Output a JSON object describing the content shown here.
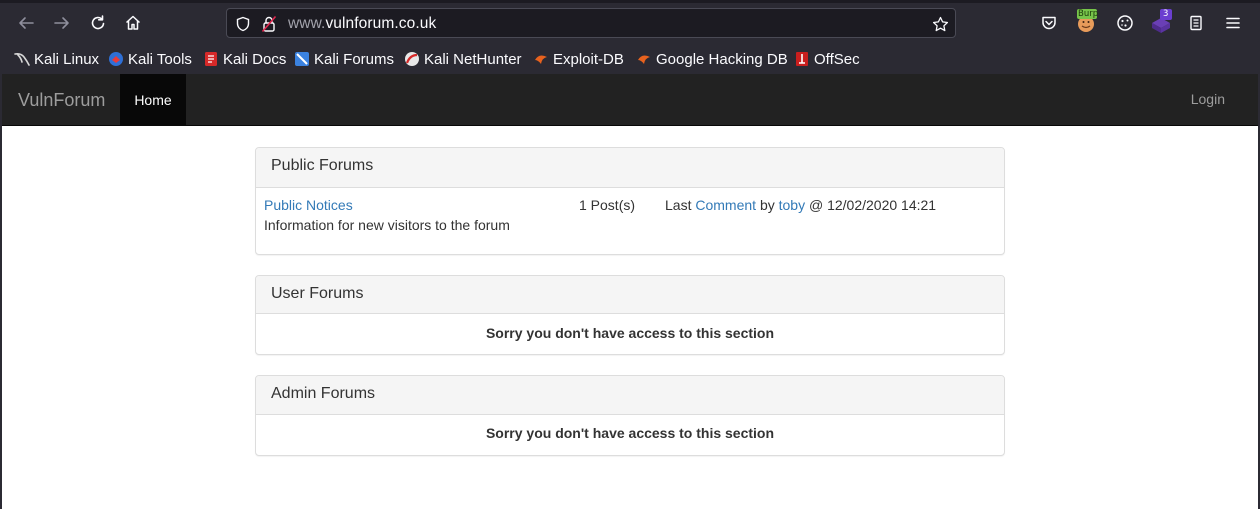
{
  "browser": {
    "url_prefix": "www.",
    "url_domain": "vulnforum.co.uk",
    "icons": {
      "back": "back-arrow-icon",
      "forward": "forward-arrow-icon",
      "reload": "reload-icon",
      "home": "home-icon",
      "shield": "tracking-protection-shield-icon",
      "insecure": "insecure-lock-icon",
      "bookmark_star": "star-icon",
      "pocket": "pocket-icon",
      "burp": "burp-extension-icon",
      "cookie": "cookie-extension-icon",
      "extension": "extension-icon",
      "reader": "reader-icon",
      "menu": "hamburger-menu-icon"
    },
    "burp_badge": "Burp",
    "extension_badge": "3",
    "bookmarks": [
      {
        "label": "Kali Linux",
        "icon": "kali-dragon-icon"
      },
      {
        "label": "Kali Tools",
        "icon": "kali-tools-icon"
      },
      {
        "label": "Kali Docs",
        "icon": "kali-docs-icon"
      },
      {
        "label": "Kali Forums",
        "icon": "kali-forums-icon"
      },
      {
        "label": "Kali NetHunter",
        "icon": "nethunter-icon"
      },
      {
        "label": "Exploit-DB",
        "icon": "exploit-db-icon"
      },
      {
        "label": "Google Hacking DB",
        "icon": "ghdb-icon"
      },
      {
        "label": "OffSec",
        "icon": "offsec-icon"
      }
    ]
  },
  "navbar": {
    "brand": "VulnForum",
    "home": "Home",
    "login": "Login"
  },
  "public_forums": {
    "title": "Public Forums",
    "forum_name": "Public Notices",
    "forum_description": "Information for new visitors to the forum",
    "posts": "1 Post(s)",
    "last_prefix": "Last",
    "last_link": "Comment",
    "by": "by",
    "author": "toby",
    "timestamp": "@ 12/02/2020 14:21"
  },
  "user_forums": {
    "title": "User Forums",
    "message": "Sorry you don't have access to this section"
  },
  "admin_forums": {
    "title": "Admin Forums",
    "message": "Sorry you don't have access to this section"
  },
  "colors": {
    "navbar_bg": "#222222",
    "link": "#337ab7",
    "panel_heading_bg": "#f5f5f5",
    "browser_chrome": "#2b2a33"
  }
}
